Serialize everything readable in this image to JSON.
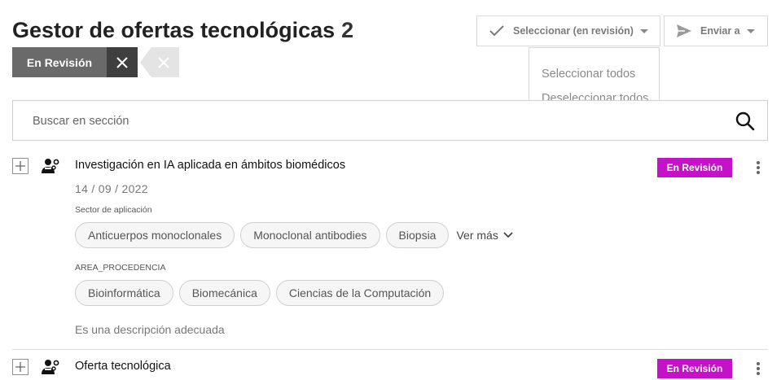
{
  "header": {
    "title": "Gestor de ofertas tecnológicas",
    "count": "2"
  },
  "filter": {
    "active_label": "En Revisión"
  },
  "toolbar": {
    "select_label": "Seleccionar (en revisión)",
    "send_label": "Enviar a"
  },
  "dropdown": {
    "options": [
      "Seleccionar todos",
      "Deseleccionar todos"
    ]
  },
  "search": {
    "placeholder": "Buscar en sección"
  },
  "items": [
    {
      "title": "Investigación en IA aplicada en ámbitos biomédicos",
      "status": "En Revisión",
      "date": "14 / 09 / 2022",
      "sector_label": "Sector de aplicación",
      "sector_tags": [
        "Anticuerpos monoclonales",
        "Monoclonal antibodies",
        "Biopsia"
      ],
      "more_label": "Ver más",
      "area_label": "AREA_PROCEDENCIA",
      "area_tags": [
        "Bioinformática",
        "Biomecánica",
        "Ciencias de la Computación"
      ],
      "description": "Es una descripción adecuada"
    },
    {
      "title": "Oferta tecnológica",
      "status": "En Revisión"
    }
  ],
  "colors": {
    "status_badge": "#c512c8",
    "chip_dark": "#6a6a6a",
    "chip_close": "#3f3f3f"
  },
  "icons": {
    "select": "check-icon",
    "send": "send-icon",
    "search": "search-icon",
    "item_type": "researchers-group-icon",
    "expand": "plus-icon",
    "menu": "kebab-menu-icon"
  }
}
